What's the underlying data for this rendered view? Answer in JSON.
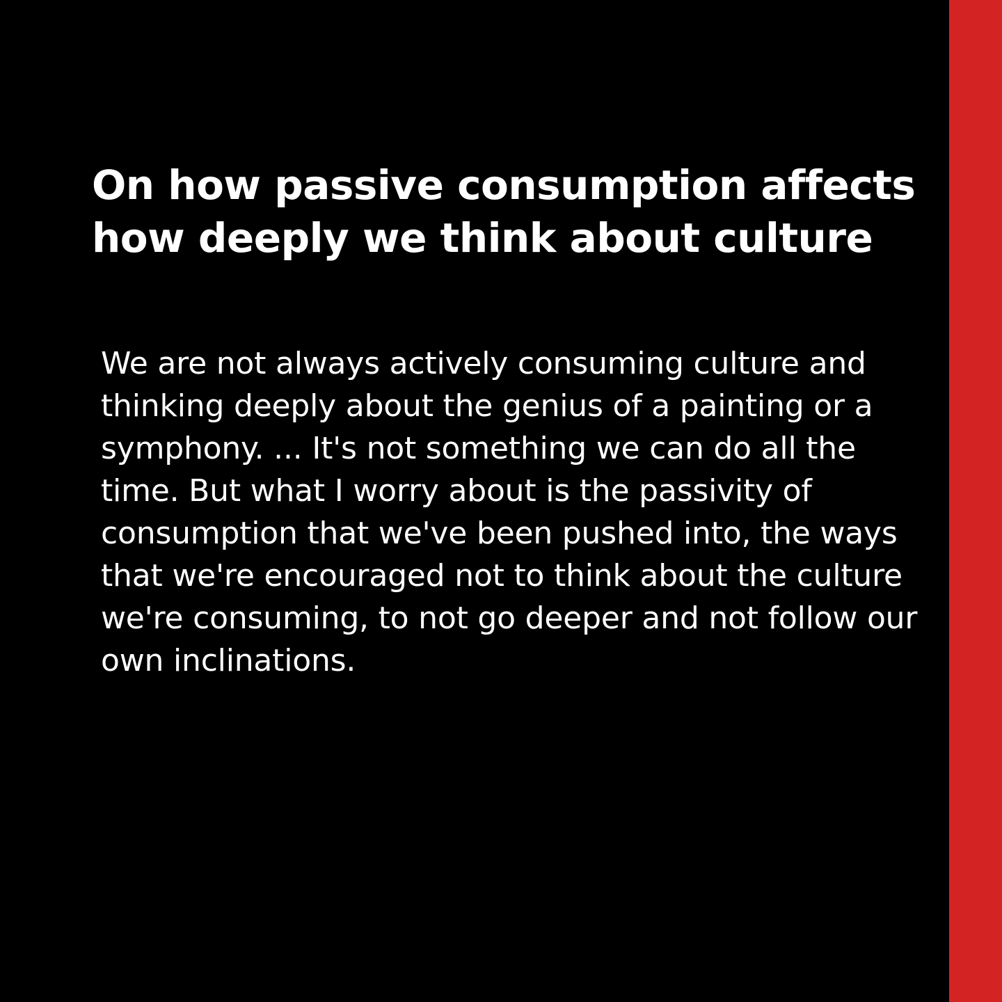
{
  "colors": {
    "background": "#000000",
    "accent": "#d42323",
    "text": "#ffffff"
  },
  "headline": "On how passive consumption affects how deeply we think about culture",
  "quote": " We are not always actively consuming culture and thinking deeply about the genius of a painting or a symphony. ... It's not something we can do all the time. But what I worry about is the passivity of consumption that we've been pushed into, the ways that we're encouraged not to think about the culture we're consuming, to not go deeper and not follow our own inclinations."
}
